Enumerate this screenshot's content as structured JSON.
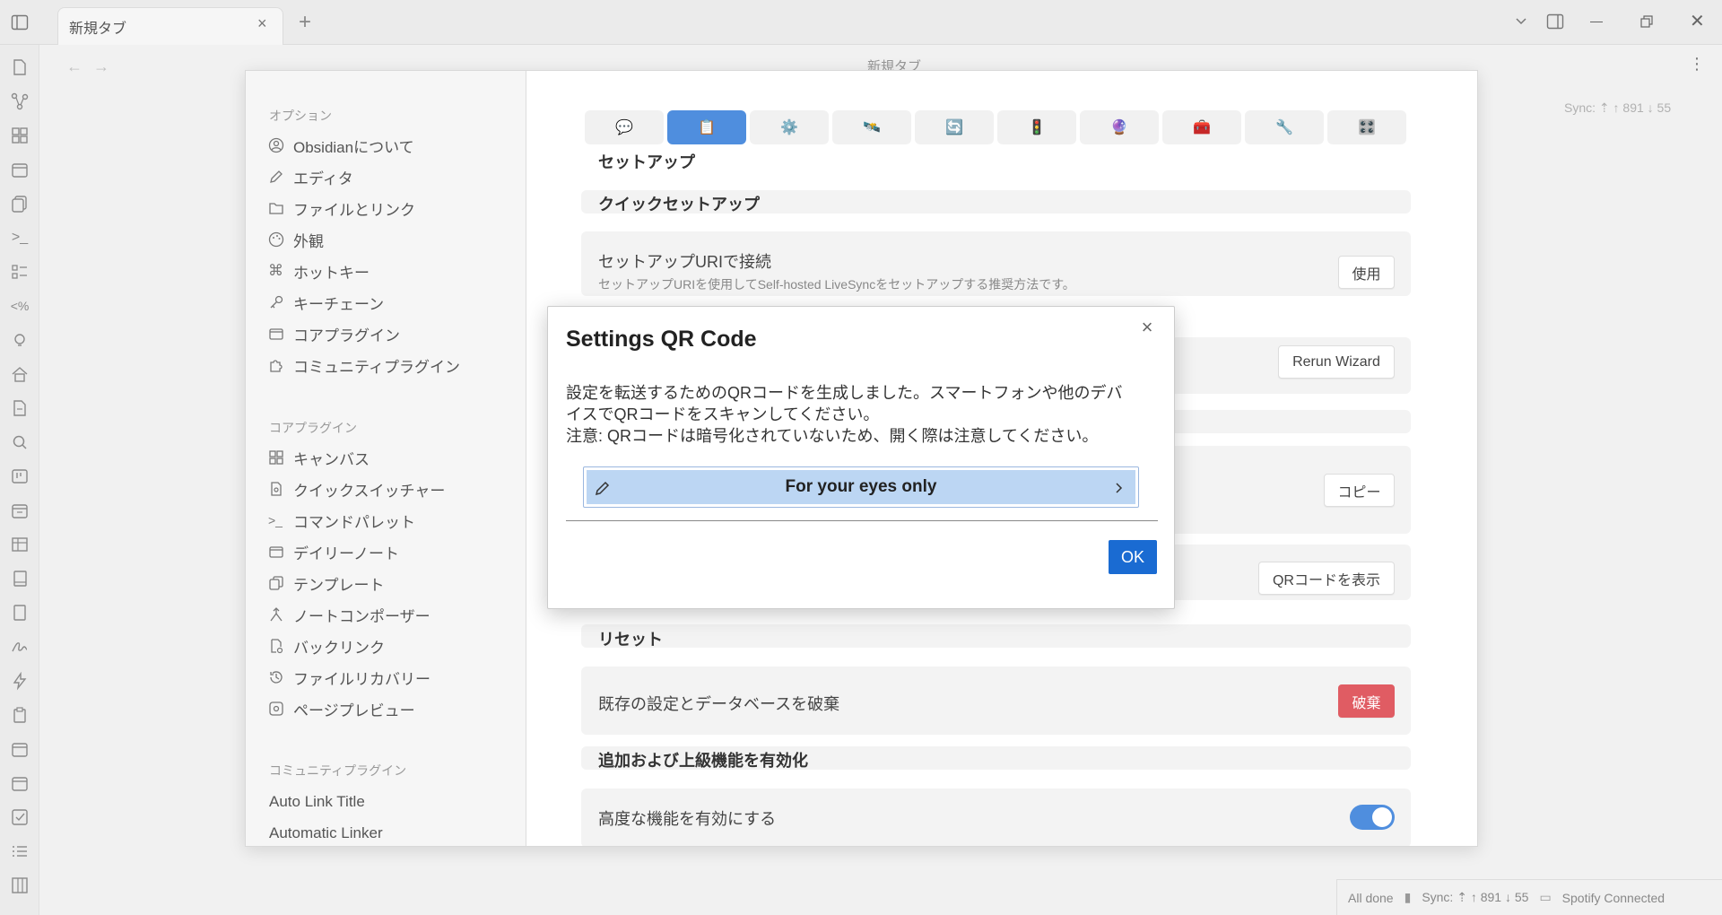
{
  "window": {
    "tab_title": "新規タブ",
    "view_title": "新規タブ",
    "sync_top": "Sync: ⇡ ↑ 891 ↓ 55"
  },
  "settings_nav": {
    "options_header": "オプション",
    "options": [
      {
        "label": "Obsidianについて",
        "icon": "user-circle-icon"
      },
      {
        "label": "エディタ",
        "icon": "pencil-icon"
      },
      {
        "label": "ファイルとリンク",
        "icon": "folder-link-icon"
      },
      {
        "label": "外観",
        "icon": "palette-icon"
      },
      {
        "label": "ホットキー",
        "icon": "command-icon"
      },
      {
        "label": "キーチェーン",
        "icon": "key-icon"
      },
      {
        "label": "コアプラグイン",
        "icon": "calendar-box-icon"
      },
      {
        "label": "コミュニティプラグイン",
        "icon": "puzzle-icon"
      }
    ],
    "core_header": "コアプラグイン",
    "core": [
      {
        "label": "キャンバス",
        "icon": "canvas-icon"
      },
      {
        "label": "クイックスイッチャー",
        "icon": "file-search-icon"
      },
      {
        "label": "コマンドパレット",
        "icon": "terminal-icon"
      },
      {
        "label": "デイリーノート",
        "icon": "calendar-icon"
      },
      {
        "label": "テンプレート",
        "icon": "copy-icon"
      },
      {
        "label": "ノートコンポーザー",
        "icon": "merge-icon"
      },
      {
        "label": "バックリンク",
        "icon": "backlink-icon"
      },
      {
        "label": "ファイルリカバリー",
        "icon": "history-icon"
      },
      {
        "label": "ページプレビュー",
        "icon": "preview-icon"
      }
    ],
    "community_header": "コミュニティプラグイン",
    "community": [
      "Auto Link Title",
      "Automatic Linker"
    ]
  },
  "plugin": {
    "icon_tabs": [
      "💬",
      "📋",
      "⚙️",
      "🛰️",
      "🔄",
      "🚦",
      "🔮",
      "🧰",
      "🔧",
      "🎛️"
    ],
    "active_tab_index": 1,
    "setup_title": "セットアップ",
    "quick_setup": "クイックセットアップ",
    "uri_name": "セットアップURIで接続",
    "uri_desc": "セットアップURIを使用してSelf-hosted LiveSyncをセットアップする推奨方法です。",
    "uri_button": "使用",
    "rerun_button": "Rerun Wizard",
    "copy_button": "コピー",
    "qr_button": "QRコードを表示",
    "reset_title": "リセット",
    "discard_name": "既存の設定とデータベースを破棄",
    "discard_button": "破棄",
    "advanced_title": "追加および上級機能を有効化",
    "advanced_name": "高度な機能を有効にする",
    "advanced_enabled": true
  },
  "qr_dialog": {
    "title": "Settings QR Code",
    "body_line1": "設定を転送するためのQRコードを生成しました。スマートフォンや他のデバ",
    "body_line2": "イスでQRコードをスキャンしてください。",
    "body_line3": "注意: QRコードは暗号化されていないため、開く際は注意してください。",
    "field_label": "For your eyes only",
    "ok_button": "OK"
  },
  "statusbar": {
    "status": "All done",
    "sync": "Sync: ⇡ ↑ 891 ↓ 55",
    "spotify": "Spotify Connected"
  }
}
